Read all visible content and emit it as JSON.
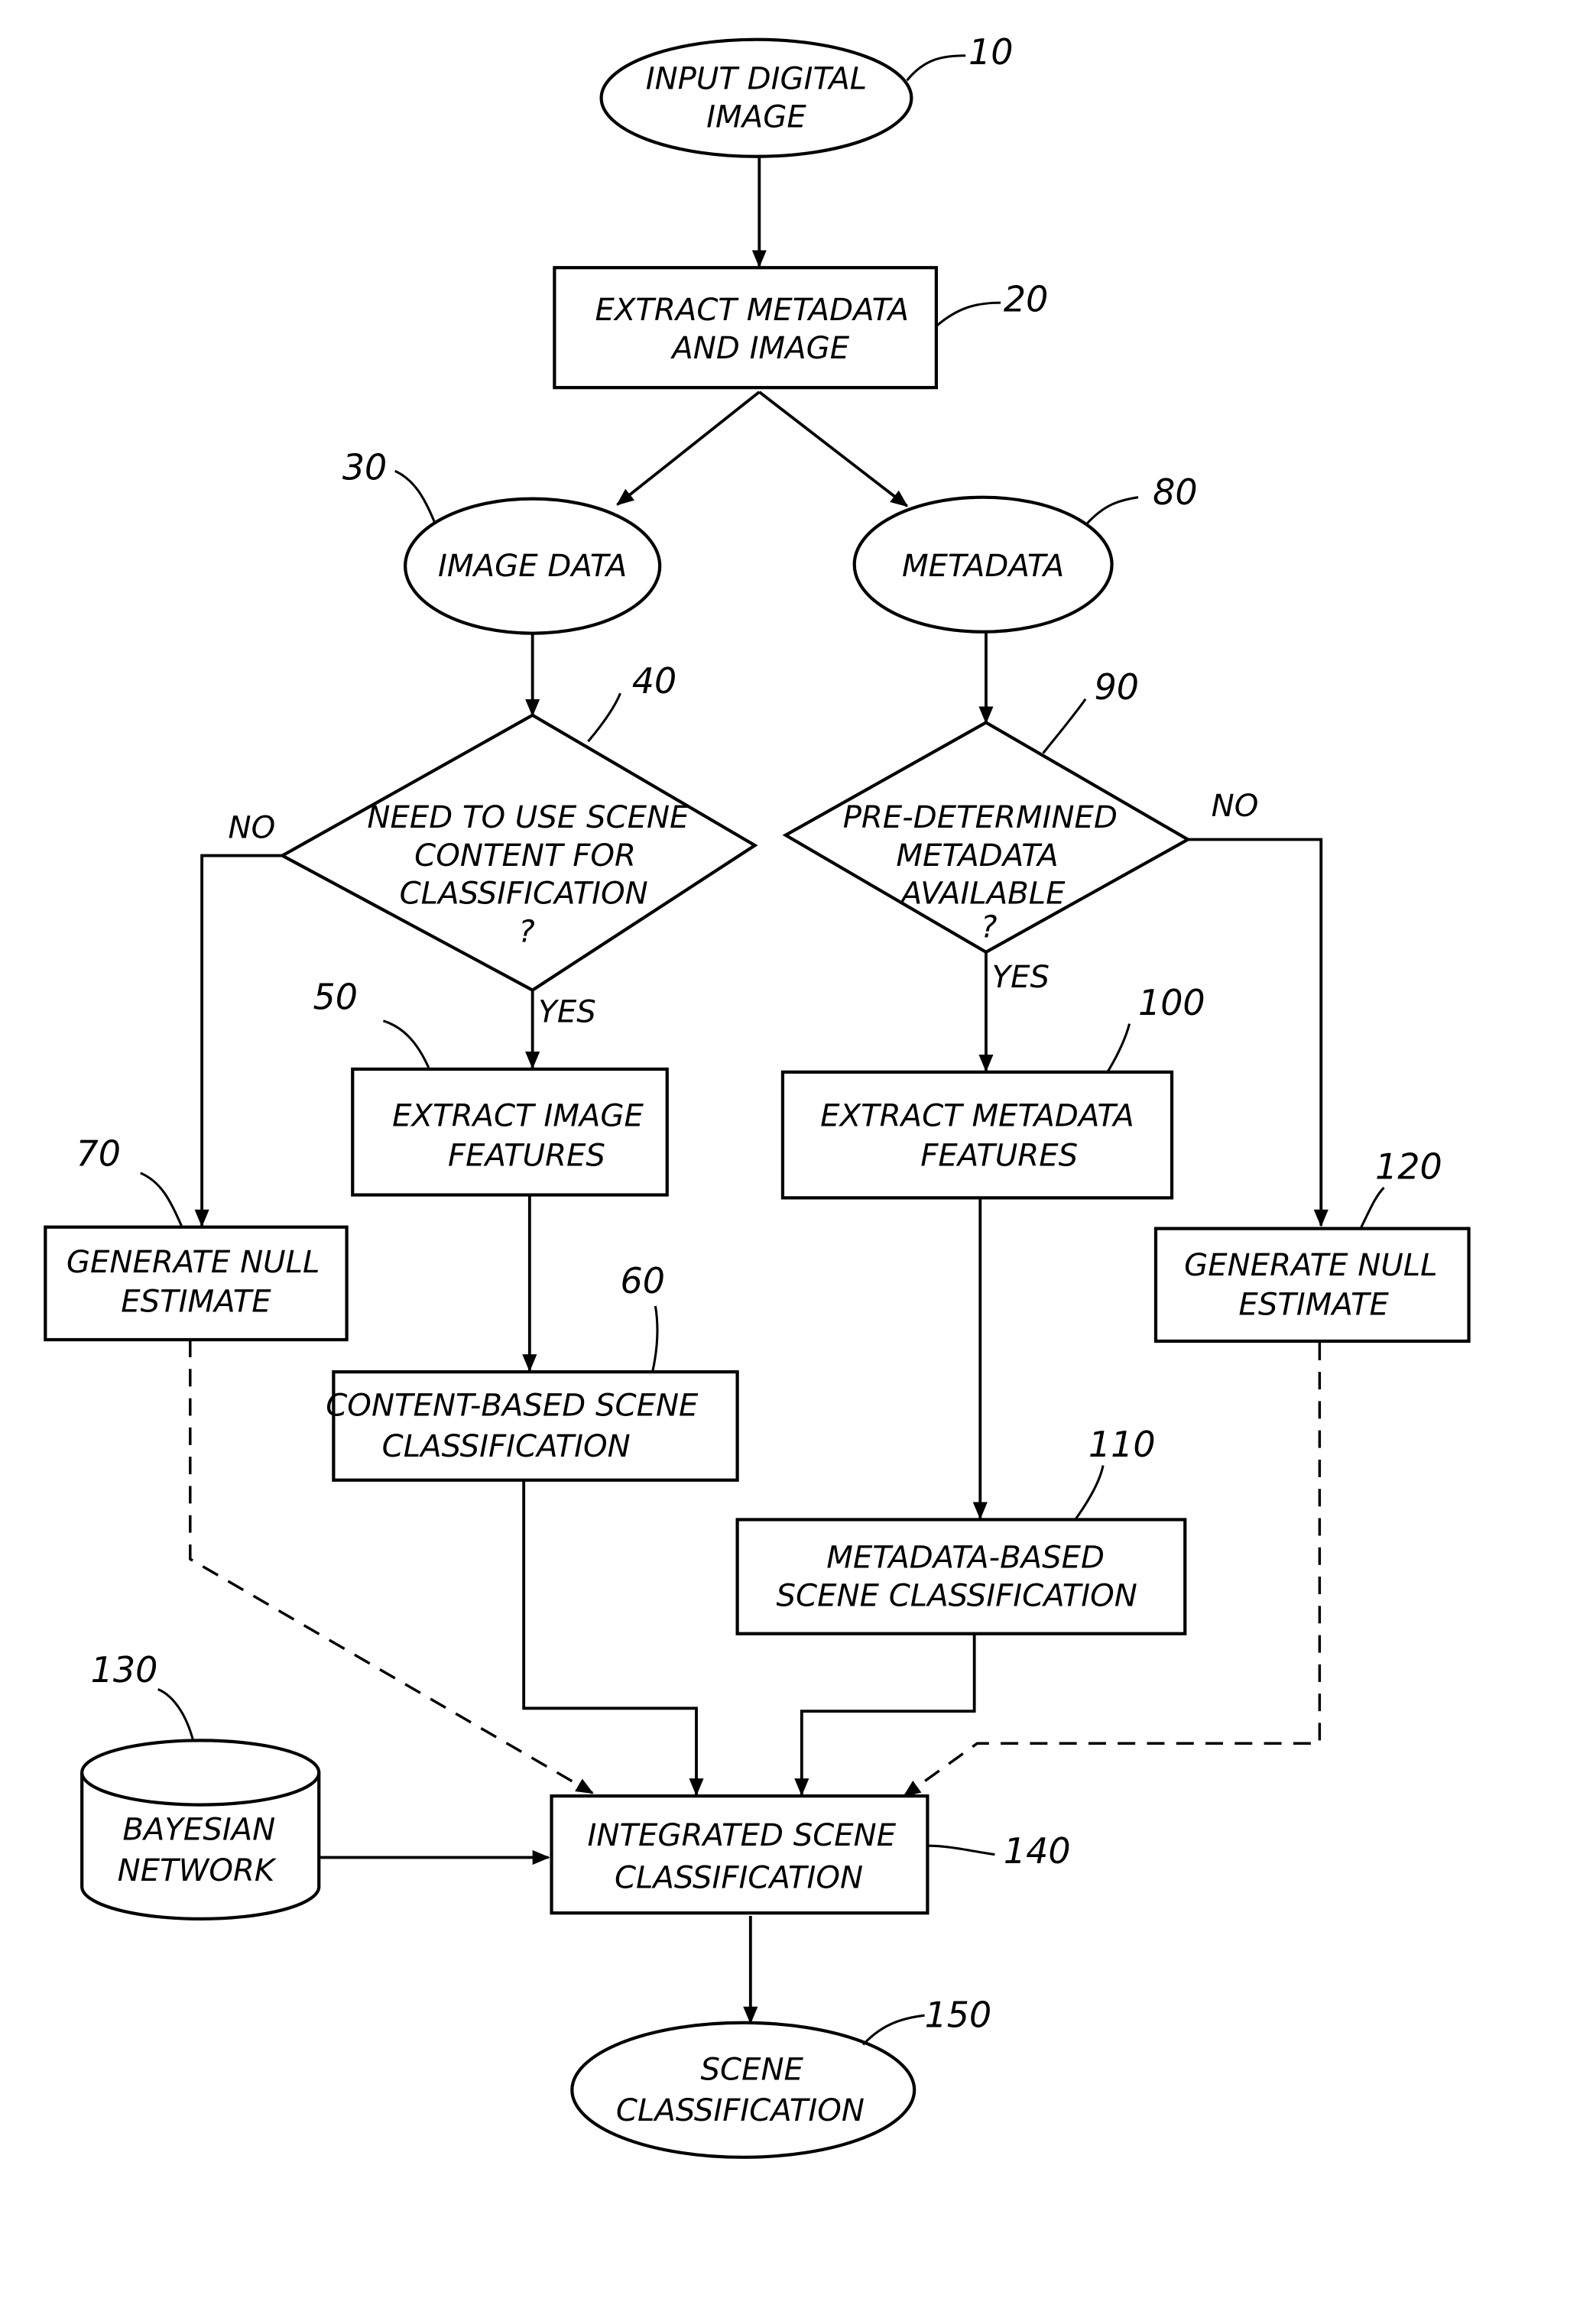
{
  "diagram": {
    "type": "flowchart",
    "nodes": {
      "n10": {
        "ref": "10",
        "shape": "ellipse",
        "lines": [
          "INPUT DIGITAL",
          "IMAGE"
        ]
      },
      "n20": {
        "ref": "20",
        "shape": "rectangle",
        "lines": [
          "EXTRACT METADATA",
          "AND IMAGE"
        ]
      },
      "n30": {
        "ref": "30",
        "shape": "ellipse",
        "lines": [
          "IMAGE DATA"
        ]
      },
      "n80": {
        "ref": "80",
        "shape": "ellipse",
        "lines": [
          "METADATA"
        ]
      },
      "n40": {
        "ref": "40",
        "shape": "diamond",
        "lines": [
          "NEED TO USE SCENE",
          "CONTENT FOR",
          "CLASSIFICATION",
          "?"
        ]
      },
      "n90": {
        "ref": "90",
        "shape": "diamond",
        "lines": [
          "PRE-DETERMINED",
          "METADATA",
          "AVAILABLE",
          "?"
        ]
      },
      "n50": {
        "ref": "50",
        "shape": "rectangle",
        "lines": [
          "EXTRACT IMAGE",
          "FEATURES"
        ]
      },
      "n100": {
        "ref": "100",
        "shape": "rectangle",
        "lines": [
          "EXTRACT METADATA",
          "FEATURES"
        ]
      },
      "n70": {
        "ref": "70",
        "shape": "rectangle",
        "lines": [
          "GENERATE NULL",
          "ESTIMATE"
        ]
      },
      "n120": {
        "ref": "120",
        "shape": "rectangle",
        "lines": [
          "GENERATE NULL",
          "ESTIMATE"
        ]
      },
      "n60": {
        "ref": "60",
        "shape": "rectangle",
        "lines": [
          "CONTENT-BASED SCENE",
          "CLASSIFICATION"
        ]
      },
      "n110": {
        "ref": "110",
        "shape": "rectangle",
        "lines": [
          "METADATA-BASED",
          "SCENE CLASSIFICATION"
        ]
      },
      "n130": {
        "ref": "130",
        "shape": "cylinder",
        "lines": [
          "BAYESIAN",
          "NETWORK"
        ]
      },
      "n140": {
        "ref": "140",
        "shape": "rectangle",
        "lines": [
          "INTEGRATED SCENE",
          "CLASSIFICATION"
        ]
      },
      "n150": {
        "ref": "150",
        "shape": "ellipse",
        "lines": [
          "SCENE",
          "CLASSIFICATION"
        ]
      }
    },
    "edge_labels": {
      "n40_no": "NO",
      "n40_yes": "YES",
      "n90_no": "NO",
      "n90_yes": "YES"
    },
    "edges": [
      {
        "from": "10",
        "to": "20",
        "style": "solid"
      },
      {
        "from": "20",
        "to": "30",
        "style": "solid"
      },
      {
        "from": "20",
        "to": "80",
        "style": "solid"
      },
      {
        "from": "30",
        "to": "40",
        "style": "solid"
      },
      {
        "from": "80",
        "to": "90",
        "style": "solid"
      },
      {
        "from": "40",
        "to": "50",
        "label": "YES",
        "style": "solid"
      },
      {
        "from": "40",
        "to": "70",
        "label": "NO",
        "style": "solid"
      },
      {
        "from": "90",
        "to": "100",
        "label": "YES",
        "style": "solid"
      },
      {
        "from": "90",
        "to": "120",
        "label": "NO",
        "style": "solid"
      },
      {
        "from": "50",
        "to": "60",
        "style": "solid"
      },
      {
        "from": "100",
        "to": "110",
        "style": "solid"
      },
      {
        "from": "60",
        "to": "140",
        "style": "solid"
      },
      {
        "from": "110",
        "to": "140",
        "style": "solid"
      },
      {
        "from": "70",
        "to": "140",
        "style": "dashed"
      },
      {
        "from": "120",
        "to": "140",
        "style": "dashed"
      },
      {
        "from": "130",
        "to": "140",
        "style": "solid"
      },
      {
        "from": "140",
        "to": "150",
        "style": "solid"
      }
    ]
  }
}
